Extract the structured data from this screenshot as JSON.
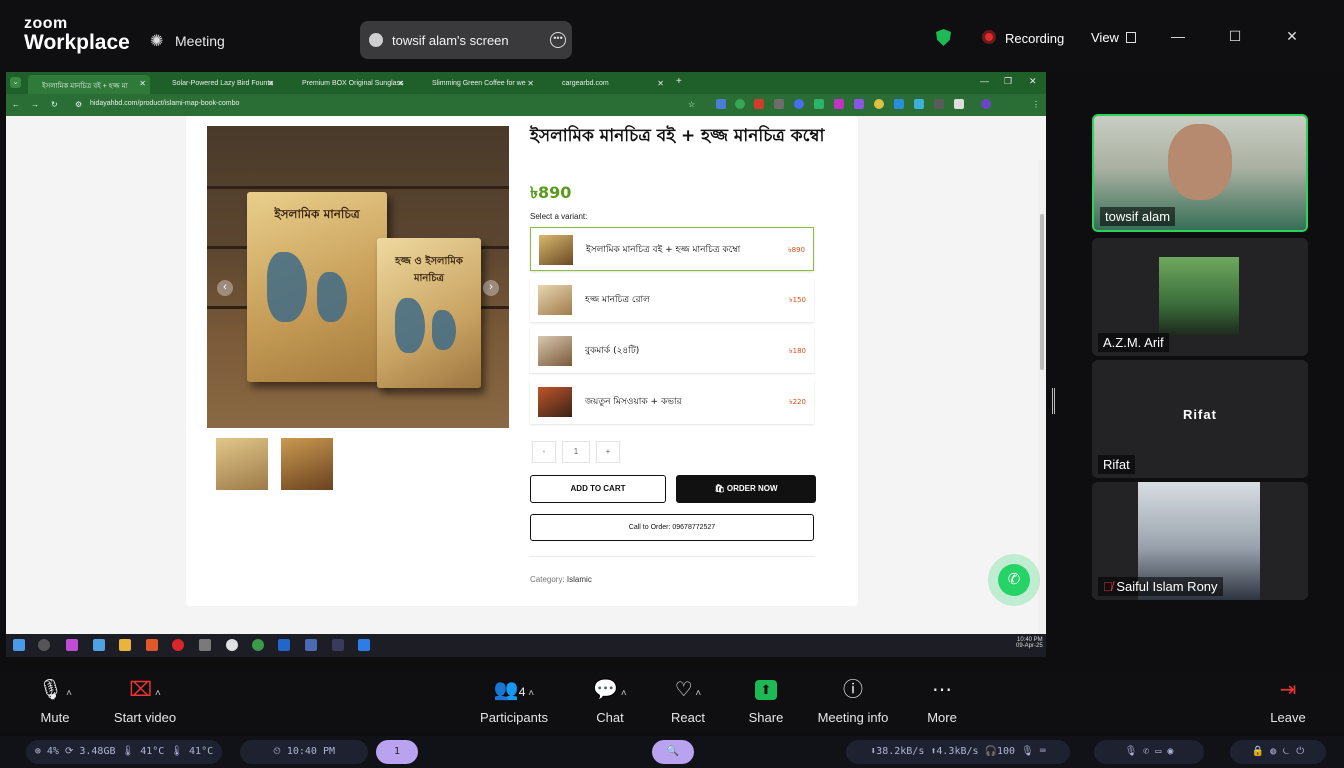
{
  "app": {
    "brand_line1": "zoom",
    "brand_line2": "Workplace",
    "meeting_label": "Meeting"
  },
  "share_pill": {
    "label": "towsif alam's screen"
  },
  "topbar": {
    "recording_label": "Recording",
    "view_label": "View",
    "colors": {
      "recording": "#e02b2b",
      "shield": "#1db954"
    }
  },
  "browser": {
    "tabs": [
      {
        "label": "ইসলামিক মানচিত্র বই + হজ্জ মা"
      },
      {
        "label": "Solar-Powered Lazy Bird Founta"
      },
      {
        "label": "Premium BOX Original Sunglass"
      },
      {
        "label": "Slimming Green Coffee for we"
      },
      {
        "label": "cargearbd.com"
      }
    ],
    "new_tab": "+",
    "url": "hidayahbd.com/product/islami-map-book-combo"
  },
  "product": {
    "title": "ইসলামিক মানচিত্র বই + হজ্জ মানচিত্র কম্বো",
    "price": "৳890",
    "book_cover_title": "ইসলামিক মানচিত্র",
    "book_small_title": "হজ্জ ও ইসলামিক মানচিত্র",
    "select_variant_label": "Select a variant:",
    "variants": [
      {
        "name": "ইসলামিক মানচিত্র বই + হজ্জ মানচিত্র কম্বো",
        "price": "৳890"
      },
      {
        "name": "হজ্জ মানচিত্র রোল",
        "price": "৳150"
      },
      {
        "name": "বুকমার্ক (২৪টি)",
        "price": "৳180"
      },
      {
        "name": "জয়তুন মিসওয়াক + কভার",
        "price": "৳220"
      }
    ],
    "qty_minus": "-",
    "qty_value": "1",
    "qty_plus": "+",
    "add_to_cart": "ADD TO CART",
    "order_now": "ORDER NOW",
    "call_to_order": "Call to Order: 09678772527",
    "category_label": "Category:",
    "category_value": "Islamic",
    "accent_color": "#5a9a1a"
  },
  "taskbar": {
    "time": "10:40 PM",
    "date": "09-Apr-25"
  },
  "participants": [
    {
      "name": "towsif alam"
    },
    {
      "name": "A.Z.M. Arif"
    },
    {
      "name": "Rifat",
      "placeholder": "Rifat"
    },
    {
      "name": "Saiful Islam Rony"
    }
  ],
  "toolbar": {
    "mute": "Mute",
    "start_video": "Start video",
    "participants": "Participants",
    "participants_count": "4",
    "chat": "Chat",
    "react": "React",
    "share": "Share",
    "meeting_info": "Meeting info",
    "more": "More",
    "leave": "Leave"
  },
  "statusbar": {
    "system": "⊕ 4%  ⟳ 3.48GB  🌡 41°C  🌡 41°C",
    "clock": "⏲ 10:40 PM",
    "workspace": "1",
    "network": "⬇38.2kB/s ⬆4.3kB/s 🎧100 🎙 ⌨"
  }
}
